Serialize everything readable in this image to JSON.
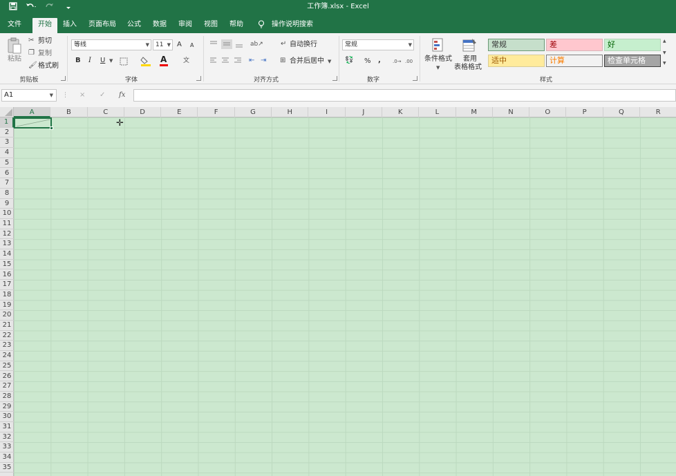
{
  "titlebar": {
    "title": "工作簿.xlsx  -  Excel",
    "save_icon": "save-icon",
    "undo_icon": "undo-icon",
    "redo_icon": "redo-icon",
    "customize_icon": "customize-toolbar-icon"
  },
  "menu": {
    "tabs": [
      "文件",
      "开始",
      "插入",
      "页面布局",
      "公式",
      "数据",
      "审阅",
      "视图",
      "帮助"
    ],
    "active_tab": "开始",
    "tell_me": "操作说明搜索"
  },
  "ribbon": {
    "clipboard": {
      "paste": "粘贴",
      "cut": "剪切",
      "copy": "复制",
      "format_painter": "格式刷",
      "label": "剪贴板"
    },
    "font": {
      "font_name": "等线",
      "font_size": "11",
      "grow": "A",
      "shrink": "A",
      "bold": "B",
      "italic": "I",
      "underline": "U",
      "font_color_glyph": "A",
      "label": "字体"
    },
    "alignment": {
      "wrap_text": "自动换行",
      "merge_center": "合并后居中",
      "label": "对齐方式"
    },
    "number": {
      "format": "常规",
      "percent": "%",
      "comma": ",",
      "label": "数字"
    },
    "styles": {
      "conditional": "条件格式",
      "table_line1": "套用",
      "table_line2": "表格格式",
      "cells": [
        {
          "label": "常规",
          "bg": "#c6dfcb",
          "fg": "#333333",
          "border": "#6a9a76"
        },
        {
          "label": "差",
          "bg": "#ffc7ce",
          "fg": "#9c0006",
          "border": "#d9b3b8"
        },
        {
          "label": "好",
          "bg": "#c6efce",
          "fg": "#006100",
          "border": "#b3d4b9"
        },
        {
          "label": "适中",
          "bg": "#ffeb9c",
          "fg": "#9c5700",
          "border": "#d9cc96"
        },
        {
          "label": "计算",
          "bg": "#f2f2f2",
          "fg": "#fa7d00",
          "border": "#7f7f7f"
        },
        {
          "label": "检查单元格",
          "bg": "#a5a5a5",
          "fg": "#ffffff",
          "border": "#3f3f3f"
        }
      ],
      "label": "样式"
    }
  },
  "formula_bar": {
    "name_box": "A1",
    "cancel": "×",
    "enter": "✓",
    "fx": "fx",
    "value": ""
  },
  "sheet": {
    "columns": [
      "A",
      "B",
      "C",
      "D",
      "E",
      "F",
      "G",
      "H",
      "I",
      "J",
      "K",
      "L",
      "M",
      "N",
      "O",
      "P",
      "Q",
      "R"
    ],
    "rows": [
      "1",
      "2",
      "3",
      "4",
      "5",
      "6",
      "7",
      "8",
      "9",
      "10",
      "11",
      "12",
      "13",
      "14",
      "15",
      "16",
      "17",
      "18",
      "19",
      "20",
      "21",
      "22",
      "23",
      "24",
      "25",
      "26",
      "27",
      "28",
      "29",
      "30",
      "31",
      "32",
      "33",
      "34",
      "35"
    ],
    "selected_cell": "A1"
  }
}
